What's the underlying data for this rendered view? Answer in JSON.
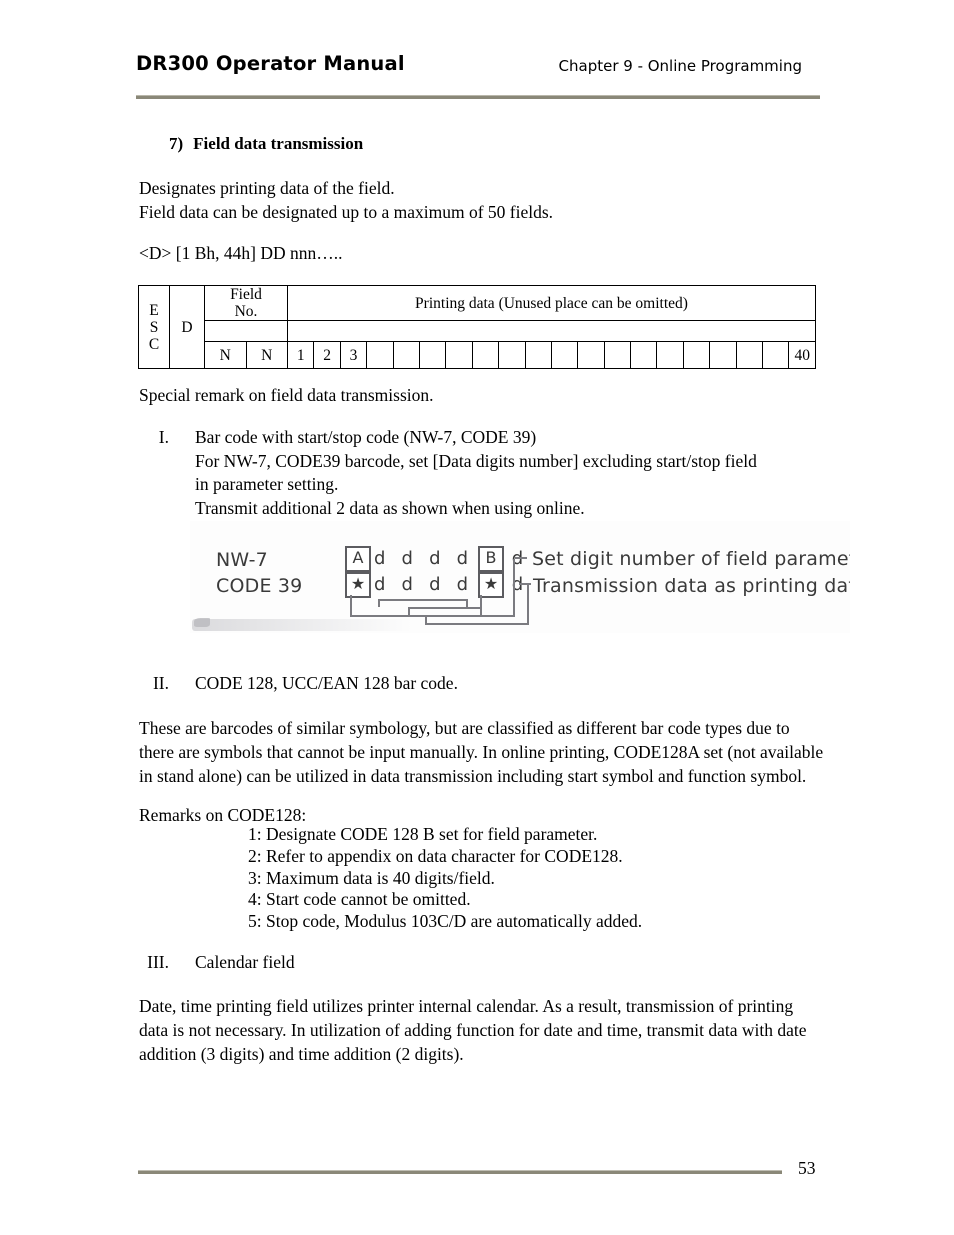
{
  "header": {
    "title": "DR300 Operator Manual",
    "chapter": "Chapter 9 - Online Programming"
  },
  "section": {
    "number": "7)",
    "heading": "Field data transmission"
  },
  "body": {
    "designates_line1": "Designates printing data of the field.",
    "designates_line2": "Field data can be designated up to a maximum of 50 fields.",
    "code_line": "<D> [1 Bh, 44h] DD nnn…..",
    "special_remark": "Special remark on field data transmission."
  },
  "format_table": {
    "esc_letters": [
      "E",
      "S",
      "C"
    ],
    "d_label": "D",
    "field_no_header_line1": "Field",
    "field_no_header_line2": "No.",
    "printing_data_header": "Printing data (Unused place can be omitted)",
    "field_no_cells": [
      "N",
      "N"
    ],
    "data_cells": [
      "1",
      "2",
      "3",
      "",
      "",
      "",
      "",
      "",
      "",
      "",
      "",
      "",
      "",
      "",
      "",
      "",
      "",
      "",
      "",
      "40"
    ]
  },
  "roman_items": [
    {
      "numeral": "I.",
      "lines": [
        "Bar code with start/stop code (NW-7, CODE 39)",
        "For NW-7, CODE39 barcode, set [Data digits number] excluding start/stop field",
        "in parameter setting.",
        "Transmit additional 2 data as shown when using online."
      ]
    },
    {
      "numeral": "II.",
      "lines": [
        "CODE 128, UCC/EAN 128 bar code."
      ]
    },
    {
      "numeral": "III.",
      "lines": [
        "Calendar field"
      ]
    }
  ],
  "figure": {
    "label_nw7": "NW-7",
    "label_code39": "CODE 39",
    "box_start_top": "A",
    "box_stop_top": "B",
    "box_start_bottom": "★",
    "box_stop_bottom": "★",
    "data_row_top": "d d d d d d",
    "data_row_bottom": "d d d d d d",
    "caption_top": "Set digit number of field parameter",
    "caption_bottom": "Transmission data as printing data"
  },
  "code128": {
    "paragraph": "These are barcodes of similar symbology, but are classified as different bar code types due to there are symbols that cannot be input manually.  In online printing, CODE128A set (not available in stand alone) can be utilized in data transmission including start symbol and function symbol.",
    "remarks_label": "Remarks on CODE128:",
    "remarks": [
      "1: Designate CODE 128 B set for field parameter.",
      "2: Refer to appendix on data character for CODE128.",
      "3: Maximum data is 40 digits/field.",
      "4: Start code cannot be omitted.",
      "5: Stop code, Modulus 103C/D are automatically added."
    ]
  },
  "calendar": {
    "paragraph": "Date, time printing field utilizes printer internal calendar.  As a result, transmission of printing data is not necessary.  In utilization of adding function for date and time, transmit data with date addition (3 digits) and time addition (2 digits)."
  },
  "footer": {
    "page_number": "53"
  },
  "colors": {
    "rule": "#8a8878",
    "text": "#000000",
    "figure_ink": "#3a3a3a"
  }
}
